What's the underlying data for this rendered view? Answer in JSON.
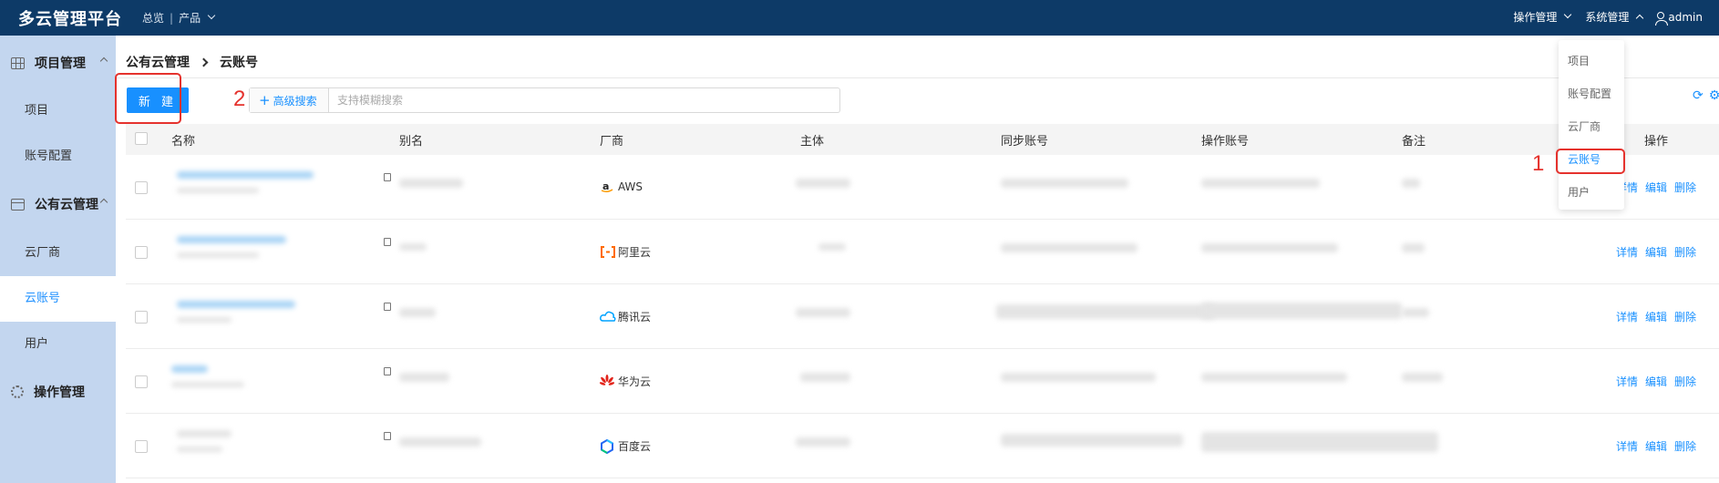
{
  "brand": "多云管理平台",
  "topnav": {
    "overview": "总览",
    "separator": "|",
    "products": "产品"
  },
  "topright": {
    "ops_menu": "操作管理",
    "sys_menu": "系统管理",
    "user": "admin"
  },
  "sidebar": {
    "groups": [
      {
        "label": "项目管理",
        "items": [
          "项目",
          "账号配置"
        ]
      },
      {
        "label": "公有云管理",
        "items": [
          "云厂商",
          "云账号",
          "用户"
        ]
      },
      {
        "label": "操作管理",
        "items": []
      }
    ],
    "active_item": "云账号"
  },
  "breadcrumb": {
    "parent": "公有云管理",
    "current": "云账号"
  },
  "toolbar": {
    "new_label": "新 建",
    "advanced_search_label": "高级搜索",
    "search_placeholder": "支持模糊搜索",
    "annotation_1": "1",
    "annotation_2": "2"
  },
  "table": {
    "columns": [
      "名称",
      "别名",
      "厂商",
      "主体",
      "同步账号",
      "操作账号",
      "备注",
      "操作"
    ],
    "rows": [
      {
        "vendor": "AWS",
        "actions": [
          "详情",
          "编辑",
          "删除"
        ]
      },
      {
        "vendor": "阿里云",
        "actions": [
          "详情",
          "编辑",
          "删除"
        ]
      },
      {
        "vendor": "腾讯云",
        "actions": [
          "详情",
          "编辑",
          "删除"
        ]
      },
      {
        "vendor": "华为云",
        "actions": [
          "详情",
          "编辑",
          "删除"
        ]
      },
      {
        "vendor": "百度云",
        "actions": [
          "详情",
          "编辑",
          "删除"
        ]
      }
    ]
  },
  "dropdown": {
    "items": [
      "项目",
      "账号配置",
      "云厂商",
      "云账号",
      "用户"
    ],
    "active": "云账号"
  },
  "colors": {
    "topbar": "#0d3a67",
    "sidebar": "#c3d6ef",
    "accent": "#1890ff",
    "annotation": "#e5322d"
  }
}
